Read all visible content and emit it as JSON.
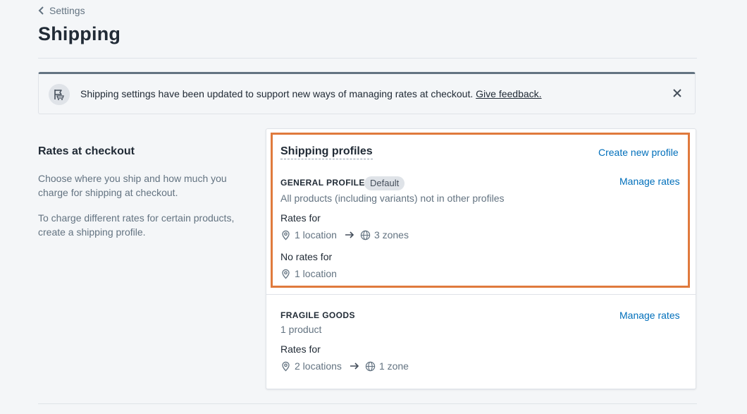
{
  "breadcrumb": {
    "label": "Settings",
    "icon": "chevron-left-icon"
  },
  "page": {
    "title": "Shipping"
  },
  "banner": {
    "icon": "flag-cart-icon",
    "text": "Shipping settings have been updated to support new ways of managing rates at checkout.",
    "link": "Give feedback.",
    "close_icon": "close-icon"
  },
  "section": {
    "title": "Rates at checkout",
    "desc1": "Choose where you ship and how much you charge for shipping at checkout.",
    "desc2": "To charge different rates for certain products, create a shipping profile."
  },
  "card": {
    "title": "Shipping profiles",
    "create_link": "Create new profile",
    "profiles": [
      {
        "name": "GENERAL PROFILE",
        "badge": "Default",
        "manage": "Manage rates",
        "subtitle": "All products (including variants) not in other profiles",
        "rates_for_label": "Rates for",
        "rates_locations": "1 location",
        "rates_zones": "3 zones",
        "no_rates_label": "No rates for",
        "no_rates_locations": "1 location"
      },
      {
        "name": "FRAGILE GOODS",
        "manage": "Manage rates",
        "subtitle": "1 product",
        "rates_for_label": "Rates for",
        "rates_locations": "2 locations",
        "rates_zones": "1 zone"
      }
    ]
  },
  "colors": {
    "link": "#006fbb",
    "highlight": "#e07a3d",
    "text": "#212b36",
    "muted": "#637381",
    "banner_border": "#637381"
  }
}
